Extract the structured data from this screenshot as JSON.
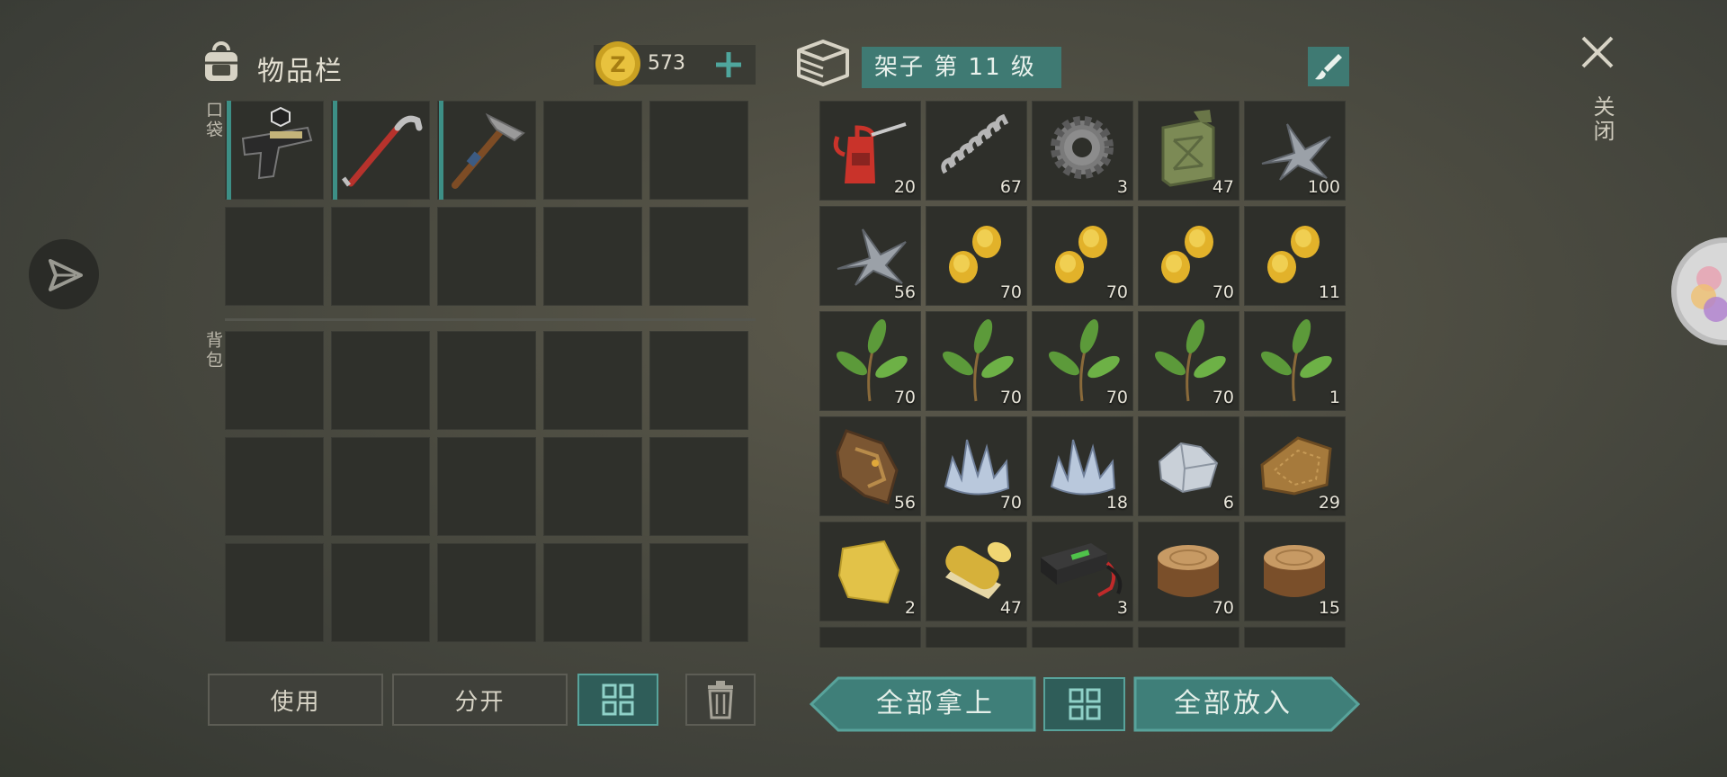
{
  "inventory": {
    "title": "物品栏",
    "coins": "573",
    "pocket_label": "口袋",
    "backpack_label": "背包"
  },
  "storage": {
    "title": "架子 第 11 级"
  },
  "close_label": "关闭",
  "buttons": {
    "use": "使用",
    "split": "分开",
    "take_all": "全部拿上",
    "put_all": "全部放入"
  },
  "pocket_items": [
    {
      "icon": "pistol-icon"
    },
    {
      "icon": "crowbar-icon"
    },
    {
      "icon": "pickaxe-icon"
    }
  ],
  "storage_items": [
    {
      "icon": "oil-can-icon",
      "count": "20"
    },
    {
      "icon": "spring-icon",
      "count": "67"
    },
    {
      "icon": "gear-icon",
      "count": "3"
    },
    {
      "icon": "jerrycan-icon",
      "count": "47"
    },
    {
      "icon": "scrap-metal-icon",
      "count": "100"
    },
    {
      "icon": "scrap-metal-icon",
      "count": "56"
    },
    {
      "icon": "corn-seeds-icon",
      "count": "70"
    },
    {
      "icon": "corn-seeds-icon",
      "count": "70"
    },
    {
      "icon": "corn-seeds-icon",
      "count": "70"
    },
    {
      "icon": "corn-seeds-icon",
      "count": "11"
    },
    {
      "icon": "leaves-icon",
      "count": "70"
    },
    {
      "icon": "leaves-icon",
      "count": "70"
    },
    {
      "icon": "leaves-icon",
      "count": "70"
    },
    {
      "icon": "leaves-icon",
      "count": "70"
    },
    {
      "icon": "leaves-icon",
      "count": "1"
    },
    {
      "icon": "raw-hide-icon",
      "count": "56"
    },
    {
      "icon": "crystal-icon",
      "count": "70"
    },
    {
      "icon": "crystal-icon",
      "count": "18"
    },
    {
      "icon": "iron-ore-icon",
      "count": "6"
    },
    {
      "icon": "leather-icon",
      "count": "29"
    },
    {
      "icon": "cloth-icon",
      "count": "2"
    },
    {
      "icon": "fabric-roll-icon",
      "count": "47"
    },
    {
      "icon": "battery-icon",
      "count": "3"
    },
    {
      "icon": "wood-log-icon",
      "count": "70"
    },
    {
      "icon": "wood-log-icon",
      "count": "15"
    }
  ],
  "colors": {
    "accent": "#3f7f79",
    "accent_border": "#58a39b",
    "slot": "#2f302b"
  }
}
